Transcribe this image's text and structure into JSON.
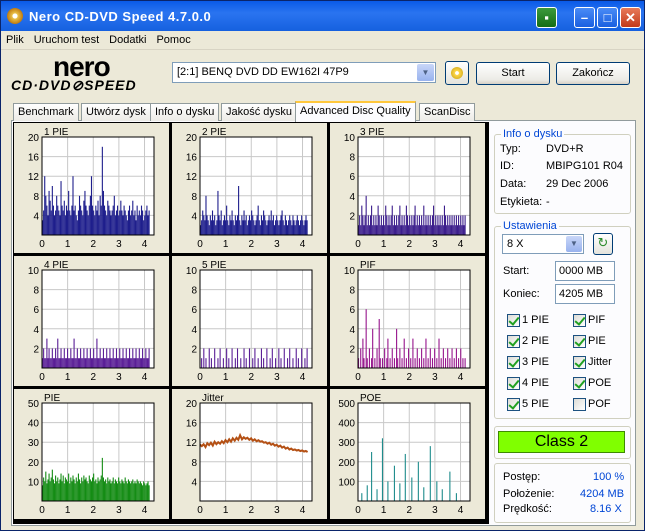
{
  "window": {
    "title": "Nero CD-DVD Speed 4.7.0.0"
  },
  "menu": [
    "Plik",
    "Uruchom test",
    "Dodatki",
    "Pomoc"
  ],
  "logo": {
    "top": "nero",
    "bottom": "CD·DVD⊘SPEED"
  },
  "drive": {
    "selected": "[2:1]  BENQ DVD DD EW162I 47P9"
  },
  "buttons": {
    "start": "Start",
    "end": "Zakończ"
  },
  "tabs": [
    "Benchmark",
    "Utwórz dysk",
    "Info o dysku",
    "Jakość dysku",
    "Advanced Disc Quality",
    "ScanDisc"
  ],
  "active_tab": "Advanced Disc Quality",
  "disc_info": {
    "title": "Info o dysku",
    "rows": [
      {
        "label": "Typ:",
        "value": "DVD+R"
      },
      {
        "label": "ID:",
        "value": "MBIPG101 R04"
      },
      {
        "label": "Data:",
        "value": "29 Dec 2006"
      },
      {
        "label": "Etykieta:",
        "value": "-"
      }
    ]
  },
  "settings": {
    "title": "Ustawienia",
    "speed": "8 X",
    "start_label": "Start:",
    "start_value": "0000 MB",
    "end_label": "Koniec:",
    "end_value": "4205 MB",
    "checks": [
      {
        "label": "1 PIE",
        "checked": true
      },
      {
        "label": "PIF",
        "checked": true
      },
      {
        "label": "2 PIE",
        "checked": true
      },
      {
        "label": "PIE",
        "checked": true
      },
      {
        "label": "3 PIE",
        "checked": true
      },
      {
        "label": "Jitter",
        "checked": true
      },
      {
        "label": "4 PIE",
        "checked": true
      },
      {
        "label": "POE",
        "checked": true
      },
      {
        "label": "5 PIE",
        "checked": true
      },
      {
        "label": "POF",
        "checked": false
      }
    ]
  },
  "class_result": "Class 2",
  "progress": {
    "rows": [
      {
        "label": "Postęp:",
        "value": "100 %"
      },
      {
        "label": "Położenie:",
        "value": "4204 MB"
      },
      {
        "label": "Prędkość:",
        "value": "8.16 X"
      }
    ]
  },
  "colors": {
    "blue": "#1e1e8c",
    "purple": "#5a1e96",
    "magenta": "#96148c",
    "green": "#148c14",
    "orange": "#b45014",
    "teal": "#1e8c8c",
    "class": "#80ff00"
  },
  "chart_data": [
    {
      "type": "bar",
      "title": "1 PIE",
      "ylim": [
        0,
        20
      ],
      "yticks": [
        4,
        8,
        12,
        16,
        20
      ],
      "xticks": [
        0,
        1,
        2,
        3,
        4
      ],
      "color": "#1e1e8c",
      "values": [
        3,
        5,
        12,
        8,
        6,
        4,
        9,
        7,
        5,
        10,
        6,
        4,
        5,
        8,
        6,
        5,
        4,
        11,
        6,
        5,
        7,
        4,
        6,
        5,
        9,
        5,
        4,
        6,
        12,
        5,
        6,
        4,
        3,
        5,
        8,
        6,
        5,
        4,
        7,
        9,
        6,
        5,
        4,
        6,
        8,
        12,
        6,
        5,
        4,
        6,
        5,
        7,
        4,
        8,
        6,
        18,
        9,
        6,
        5,
        4,
        7,
        6,
        5,
        4,
        5,
        6,
        8,
        4,
        5,
        6,
        4,
        5,
        7,
        5,
        4,
        6,
        5,
        4,
        3,
        5,
        6,
        4,
        5,
        7,
        4,
        5,
        3,
        6,
        4,
        5,
        4,
        6,
        5,
        3,
        4,
        5,
        6,
        4,
        5
      ]
    },
    {
      "type": "bar",
      "title": "2 PIE",
      "ylim": [
        0,
        20
      ],
      "yticks": [
        4,
        8,
        12,
        16,
        20
      ],
      "xticks": [
        0,
        1,
        2,
        3,
        4
      ],
      "color": "#1e1e8c",
      "values": [
        2,
        3,
        5,
        4,
        3,
        8,
        4,
        3,
        2,
        4,
        3,
        5,
        3,
        4,
        2,
        3,
        9,
        4,
        3,
        5,
        2,
        3,
        4,
        3,
        6,
        3,
        2,
        4,
        3,
        5,
        3,
        2,
        4,
        3,
        4,
        10,
        3,
        2,
        4,
        3,
        5,
        3,
        4,
        2,
        3,
        4,
        3,
        5,
        4,
        3,
        2,
        3,
        4,
        6,
        3,
        2,
        4,
        3,
        5,
        4,
        3,
        2,
        3,
        4,
        3,
        5,
        3,
        4,
        2,
        3,
        4,
        3,
        2,
        3,
        4,
        5,
        3,
        2,
        4,
        3,
        2,
        3,
        4,
        3,
        2,
        4,
        3,
        2,
        3,
        4,
        3,
        2,
        3,
        4,
        3,
        2,
        3,
        4,
        3
      ]
    },
    {
      "type": "bar",
      "title": "3 PIE",
      "ylim": [
        0,
        10
      ],
      "yticks": [
        2,
        4,
        6,
        8,
        10
      ],
      "xticks": [
        0,
        1,
        2,
        3,
        4
      ],
      "color": "#3c1e8c",
      "values": [
        1,
        2,
        1,
        3,
        2,
        1,
        2,
        4,
        1,
        2,
        1,
        2,
        3,
        1,
        2,
        1,
        2,
        1,
        3,
        2,
        1,
        2,
        1,
        2,
        1,
        3,
        2,
        1,
        2,
        1,
        2,
        3,
        1,
        2,
        1,
        2,
        1,
        2,
        3,
        1,
        2,
        1,
        2,
        1,
        3,
        2,
        1,
        2,
        1,
        2,
        1,
        2,
        3,
        1,
        2,
        1,
        2,
        1,
        2,
        1,
        3,
        1,
        2,
        1,
        2,
        1,
        2,
        1,
        2,
        3,
        1,
        2,
        1,
        2,
        1,
        2,
        1,
        2,
        1,
        3,
        2,
        1,
        2,
        1,
        2,
        1,
        2,
        1,
        2,
        1,
        2,
        1,
        2,
        1,
        2,
        1,
        2,
        1,
        2
      ]
    },
    {
      "type": "bar",
      "title": "4 PIE",
      "ylim": [
        0,
        10
      ],
      "yticks": [
        2,
        4,
        6,
        8,
        10
      ],
      "xticks": [
        0,
        1,
        2,
        3,
        4
      ],
      "color": "#5a1e96",
      "values": [
        1,
        2,
        1,
        1,
        3,
        1,
        2,
        1,
        1,
        2,
        1,
        1,
        2,
        1,
        3,
        1,
        1,
        2,
        1,
        1,
        2,
        1,
        1,
        2,
        1,
        1,
        2,
        1,
        1,
        3,
        1,
        1,
        2,
        1,
        1,
        2,
        1,
        1,
        2,
        1,
        1,
        2,
        1,
        1,
        2,
        1,
        1,
        2,
        1,
        1,
        3,
        1,
        1,
        2,
        1,
        1,
        2,
        1,
        1,
        2,
        1,
        1,
        2,
        1,
        1,
        2,
        1,
        1,
        2,
        1,
        1,
        2,
        1,
        1,
        2,
        1,
        1,
        2,
        1,
        1,
        2,
        1,
        1,
        2,
        1,
        1,
        2,
        1,
        1,
        2,
        1,
        1,
        2,
        1,
        1,
        2,
        1,
        1,
        2
      ]
    },
    {
      "type": "bar",
      "title": "5 PIE",
      "ylim": [
        0,
        10
      ],
      "yticks": [
        2,
        4,
        6,
        8,
        10
      ],
      "xticks": [
        0,
        1,
        2,
        3,
        4
      ],
      "color": "#5a1e96",
      "values": [
        0,
        1,
        0,
        2,
        0,
        1,
        0,
        0,
        2,
        0,
        1,
        0,
        0,
        2,
        0,
        0,
        1,
        0,
        2,
        0,
        0,
        1,
        0,
        0,
        2,
        0,
        1,
        0,
        0,
        2,
        0,
        0,
        1,
        0,
        2,
        0,
        0,
        1,
        0,
        0,
        2,
        0,
        1,
        0,
        0,
        2,
        0,
        0,
        1,
        0,
        2,
        0,
        0,
        1,
        0,
        0,
        2,
        0,
        1,
        0,
        0,
        2,
        0,
        0,
        1,
        0,
        2,
        0,
        0,
        1,
        0,
        0,
        2,
        0,
        1,
        0,
        0,
        2,
        0,
        0,
        1,
        0,
        2,
        0,
        0,
        1,
        0,
        0,
        2,
        0,
        1,
        0,
        0,
        2,
        0,
        0,
        1,
        0,
        2
      ]
    },
    {
      "type": "bar",
      "title": "PIF",
      "ylim": [
        0,
        10
      ],
      "yticks": [
        2,
        4,
        6,
        8,
        10
      ],
      "xticks": [
        0,
        1,
        2,
        3,
        4
      ],
      "color": "#96148c",
      "values": [
        1,
        0,
        2,
        0,
        3,
        1,
        0,
        6,
        1,
        0,
        2,
        0,
        1,
        4,
        0,
        1,
        0,
        2,
        0,
        5,
        1,
        0,
        1,
        0,
        2,
        0,
        1,
        3,
        0,
        1,
        0,
        2,
        0,
        1,
        0,
        4,
        1,
        0,
        2,
        0,
        1,
        0,
        3,
        0,
        1,
        0,
        2,
        0,
        1,
        0,
        3,
        0,
        1,
        0,
        2,
        0,
        1,
        0,
        2,
        0,
        1,
        0,
        3,
        0,
        1,
        0,
        2,
        0,
        1,
        0,
        2,
        0,
        1,
        0,
        3,
        0,
        1,
        0,
        2,
        0,
        1,
        0,
        2,
        0,
        1,
        0,
        2,
        0,
        1,
        0,
        2,
        0,
        1,
        0,
        2,
        0,
        1,
        0,
        1
      ]
    },
    {
      "type": "bar",
      "title": "PIE",
      "ylim": [
        0,
        50
      ],
      "yticks": [
        10,
        20,
        30,
        40,
        50
      ],
      "xticks": [
        0,
        1,
        2,
        3,
        4
      ],
      "color": "#148c14",
      "values": [
        8,
        12,
        10,
        15,
        9,
        11,
        14,
        10,
        12,
        16,
        11,
        9,
        13,
        10,
        12,
        9,
        11,
        14,
        10,
        13,
        9,
        12,
        11,
        10,
        14,
        9,
        12,
        10,
        13,
        11,
        9,
        12,
        10,
        14,
        11,
        9,
        12,
        10,
        13,
        11,
        12,
        10,
        9,
        13,
        11,
        10,
        12,
        14,
        10,
        11,
        9,
        12,
        10,
        11,
        13,
        22,
        12,
        10,
        11,
        9,
        12,
        10,
        11,
        9,
        10,
        12,
        9,
        11,
        10,
        9,
        12,
        10,
        9,
        11,
        10,
        9,
        12,
        10,
        9,
        11,
        10,
        9,
        10,
        11,
        9,
        10,
        9,
        11,
        10,
        9,
        10,
        9,
        8,
        10,
        9,
        8,
        9,
        10,
        8
      ]
    },
    {
      "type": "line",
      "title": "Jitter",
      "ylim": [
        0,
        20
      ],
      "yticks": [
        4,
        8,
        12,
        16,
        20
      ],
      "xticks": [
        0,
        1,
        2,
        3,
        4
      ],
      "color": "#b45014",
      "values": [
        11.5,
        11.2,
        11.6,
        11,
        11.8,
        11.4,
        11.9,
        11.3,
        12.1,
        11.6,
        12,
        11.7,
        12.2,
        11.8,
        12.4,
        12,
        12.6,
        12.1,
        12.8,
        12.3,
        12.9,
        12.5,
        13.4,
        12.6,
        13,
        12.7,
        12.9,
        12.5,
        12.8,
        12.3,
        12.6,
        12.2,
        12.4,
        12.1,
        12.2,
        11.9,
        12,
        11.7,
        11.9,
        11.5,
        11.7,
        11.3,
        11.5,
        11.1,
        11.3,
        10.9,
        11.1,
        10.7,
        10.9,
        10.5,
        10.7,
        10.4,
        10.5,
        10.3,
        10.4,
        10.2,
        10.3,
        10.1,
        10.2,
        10
      ]
    },
    {
      "type": "bar",
      "title": "POE",
      "ylim": [
        0,
        500
      ],
      "yticks": [
        100,
        200,
        300,
        400,
        500
      ],
      "xticks": [
        0,
        1,
        2,
        3,
        4
      ],
      "color": "#1e8c8c",
      "values": [
        0,
        0,
        0,
        40,
        0,
        0,
        0,
        0,
        80,
        0,
        0,
        0,
        250,
        0,
        0,
        0,
        0,
        60,
        0,
        0,
        0,
        0,
        320,
        0,
        0,
        0,
        0,
        100,
        0,
        0,
        0,
        0,
        0,
        180,
        0,
        0,
        0,
        0,
        90,
        0,
        0,
        0,
        0,
        240,
        0,
        0,
        0,
        0,
        0,
        120,
        0,
        0,
        0,
        0,
        0,
        200,
        0,
        0,
        0,
        0,
        70,
        0,
        0,
        0,
        0,
        0,
        280,
        0,
        0,
        0,
        0,
        0,
        100,
        0,
        0,
        0,
        0,
        60,
        0,
        0,
        0,
        0,
        0,
        0,
        150,
        0,
        0,
        0,
        0,
        0,
        40,
        0,
        0,
        0,
        0,
        0,
        0,
        0,
        0
      ]
    }
  ]
}
